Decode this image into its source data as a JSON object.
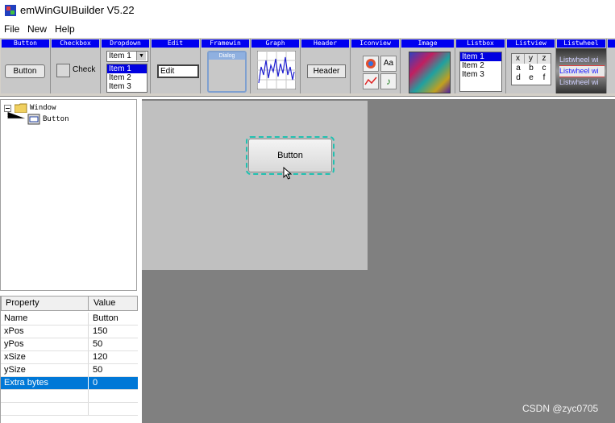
{
  "window": {
    "title": "emWinGUIBuilder V5.22"
  },
  "menu": {
    "items": [
      "File",
      "New",
      "Help"
    ]
  },
  "toolbar": {
    "titles": [
      "Button",
      "Checkbox",
      "Dropdown",
      "Edit",
      "Framewin",
      "Graph",
      "Header",
      "Iconview",
      "Image",
      "Listbox",
      "Listview",
      "Listwheel"
    ],
    "button_label": "Button",
    "checkbox_label": "Check",
    "dropdown": {
      "selected": "Item 1",
      "items": [
        "Item 1",
        "Item 2",
        "Item 3"
      ]
    },
    "edit_value": "Edit",
    "framewin_caption": "Dialog",
    "header_label": "Header",
    "iconview_text": "Aa",
    "listbox_items": [
      "Item 1",
      "Item 2",
      "Item 3"
    ],
    "listview_cells": [
      "x",
      "y",
      "z",
      "a",
      "b",
      "c",
      "d",
      "e",
      "f"
    ],
    "listwheel_items": [
      "Listwheel wi",
      "Listwheel wi",
      "Listwheel wi"
    ]
  },
  "tree": {
    "root": "Window",
    "child": "Button"
  },
  "properties": {
    "headers": [
      "Property",
      "Value"
    ],
    "rows": [
      {
        "name": "Name",
        "value": "Button"
      },
      {
        "name": "xPos",
        "value": "150"
      },
      {
        "name": "yPos",
        "value": "50"
      },
      {
        "name": "xSize",
        "value": "120"
      },
      {
        "name": "ySize",
        "value": "50"
      },
      {
        "name": "Extra bytes",
        "value": "0"
      }
    ]
  },
  "canvas": {
    "button_label": "Button"
  },
  "watermark": "CSDN @zyc0705",
  "colors": {
    "tool_title": "#0000f0",
    "selection": "#0078d7",
    "canvas_bg": "#808080",
    "dialog_bg": "#c0c0c0"
  }
}
